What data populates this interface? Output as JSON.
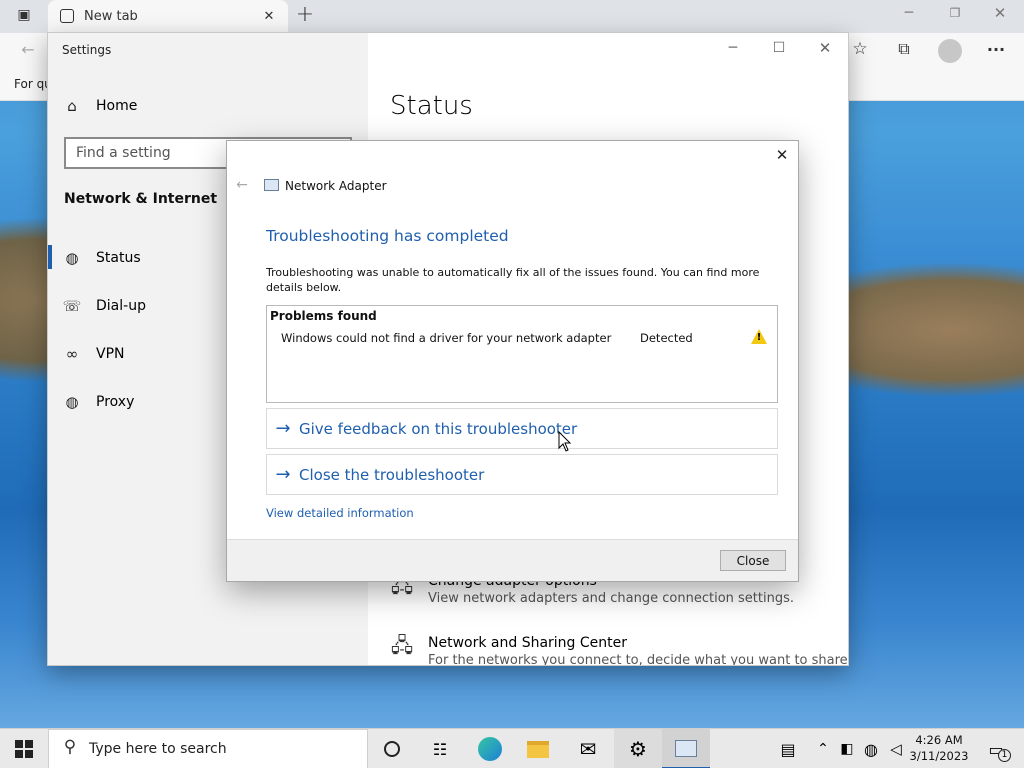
{
  "browser": {
    "tab_title": "New tab",
    "tab_close": "✕",
    "new_tab": "+",
    "favbar_text": "For qu",
    "more": "···"
  },
  "settings": {
    "title": "Settings",
    "home_label": "Home",
    "search_placeholder": "Find a setting",
    "section_title": "Network & Internet",
    "nav": [
      {
        "label": "Status",
        "icon": "globe-icon"
      },
      {
        "label": "Dial-up",
        "icon": "dialup-icon"
      },
      {
        "label": "VPN",
        "icon": "vpn-icon"
      },
      {
        "label": "Proxy",
        "icon": "globe-icon"
      }
    ],
    "main_title": "Status",
    "options": [
      {
        "title": "Change adapter options",
        "desc": "View network adapters and change connection settings."
      },
      {
        "title": "Network and Sharing Center",
        "desc": "For the networks you connect to, decide what you want to share."
      }
    ]
  },
  "dialog": {
    "title": "Network Adapter",
    "heading": "Troubleshooting has completed",
    "description": "Troubleshooting was unable to automatically fix all of the issues found. You can find more details below.",
    "problems_header": "Problems found",
    "problems": [
      {
        "text": "Windows could not find a driver for your network adapter",
        "status": "Detected"
      }
    ],
    "link_feedback": "Give feedback on this troubleshooter",
    "link_close": "Close the troubleshooter",
    "detail_link": "View detailed information",
    "close_button": "Close"
  },
  "taskbar": {
    "search_placeholder": "Type here to search",
    "time": "4:26 AM",
    "date": "3/11/2023",
    "notification_count": "1"
  },
  "colors": {
    "accent": "#1f5fae",
    "warning": "#f2c811"
  }
}
